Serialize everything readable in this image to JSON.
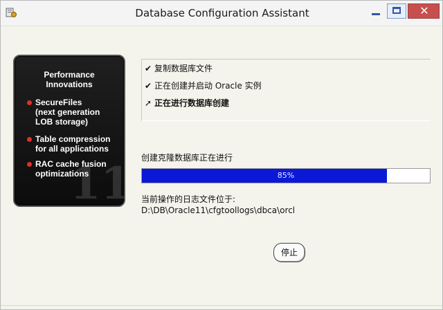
{
  "window": {
    "title": "Database Configuration Assistant",
    "close_glyph": "✕"
  },
  "promo": {
    "heading_line1": "Performance",
    "heading_line2": "Innovations",
    "items": [
      {
        "line1": "SecureFiles",
        "line2": "(next generation",
        "line3": "LOB storage)"
      },
      {
        "line1": "Table compression",
        "line2": "for all applications"
      },
      {
        "line1": "RAC cache fusion",
        "line2": "optimizations"
      }
    ]
  },
  "steps": [
    {
      "mark": "✔",
      "label": "复制数据库文件",
      "status": "done"
    },
    {
      "mark": "✔",
      "label": "正在创建并启动 Oracle 实例",
      "status": "done"
    },
    {
      "mark": "➚",
      "label": "正在进行数据库创建",
      "status": "current"
    }
  ],
  "progress": {
    "label": "创建克隆数据库正在进行",
    "percent": 85,
    "text": "85%"
  },
  "log": {
    "label": "当前操作的日志文件位于:",
    "path": "D:\\DB\\Oracle11\\cfgtoollogs\\dbca\\orcl"
  },
  "buttons": {
    "stop": "停止"
  },
  "colors": {
    "progress_fill": "#0b18d8",
    "close_button": "#c7504f",
    "bullet": "#e0302a"
  }
}
